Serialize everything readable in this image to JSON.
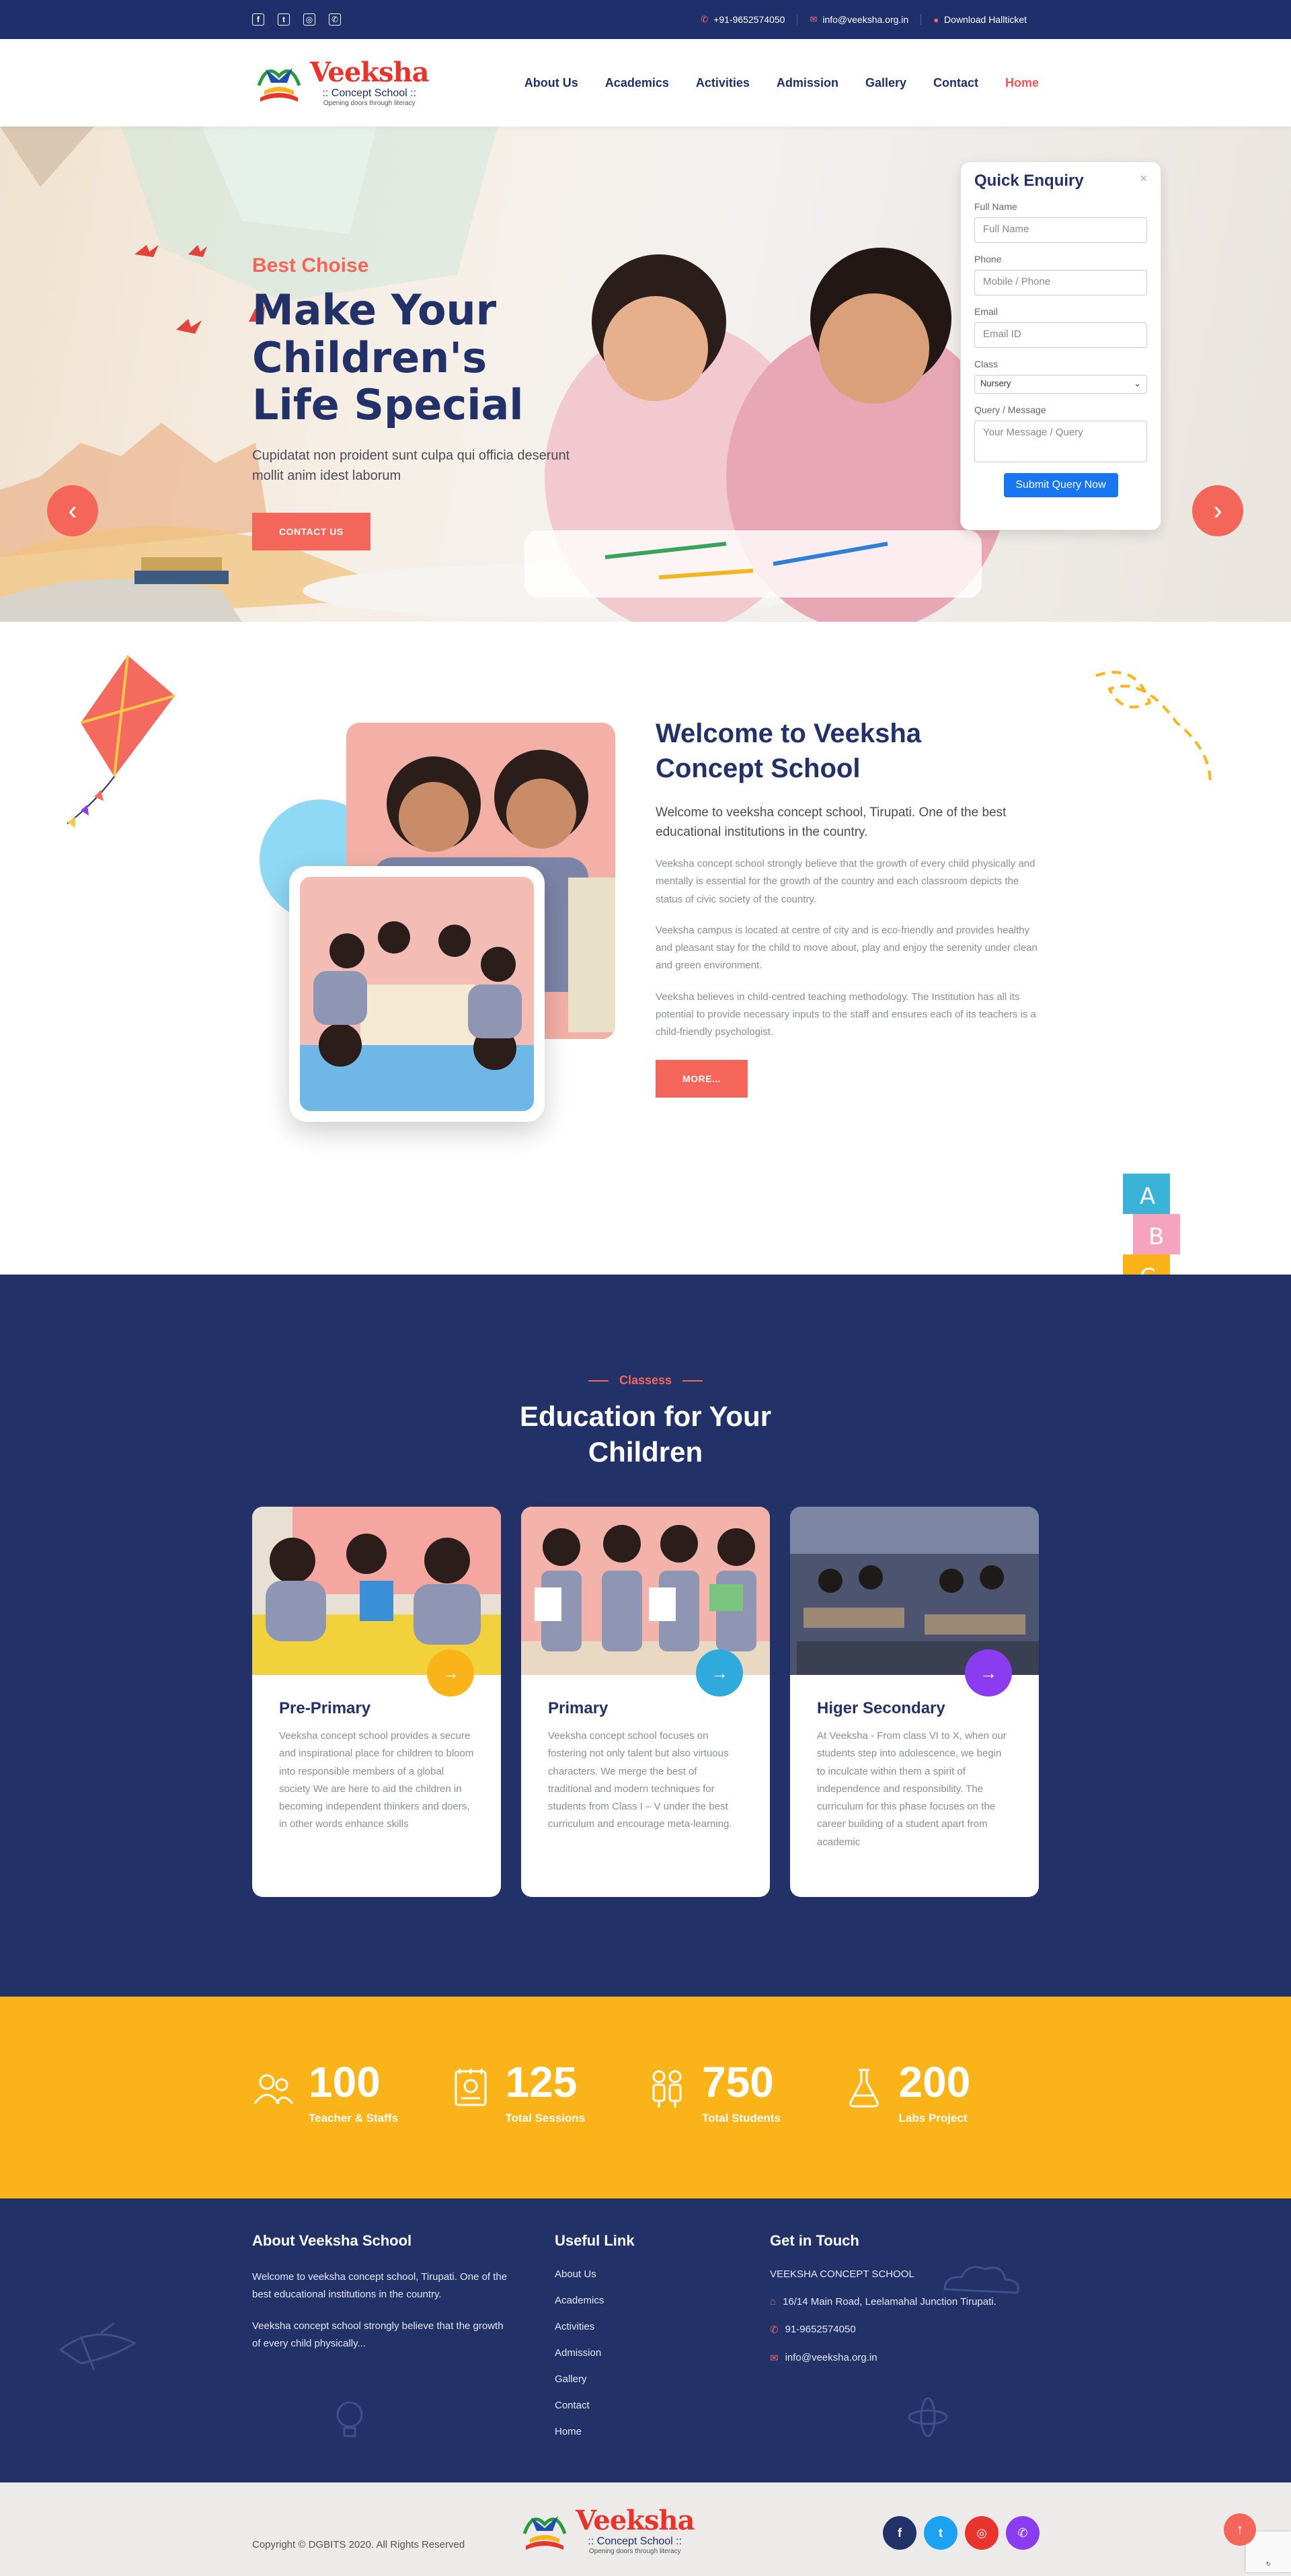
{
  "topbar": {
    "phone": "+91-9652574050",
    "email": "info@veeksha.org.in",
    "hallticket": "Download Hallticket"
  },
  "logo": {
    "name": "Veeksha",
    "sub": "Concept School",
    "tagline": "Opening doors through literacy"
  },
  "nav": [
    "About Us",
    "Academics",
    "Activities",
    "Admission",
    "Gallery",
    "Contact",
    "Home"
  ],
  "hero": {
    "kicker": "Best Choise",
    "title_line1": "Make Your Children's",
    "title_line2": "Life Special",
    "text": "Cupidatat non proident sunt culpa qui officia deserunt mollit anim idest laborum",
    "button": "CONTACT US"
  },
  "enquiry": {
    "title": "Quick Enquiry",
    "close": "×",
    "fields": [
      {
        "label": "Full Name",
        "placeholder": "Full Name"
      },
      {
        "label": "Phone",
        "placeholder": "Mobile / Phone"
      },
      {
        "label": "Email",
        "placeholder": "Email ID"
      }
    ],
    "class_label": "Class",
    "class_value": "Nursery",
    "message_label": "Query / Message",
    "message_placeholder": "Your Message / Query",
    "submit": "Submit Query Now"
  },
  "welcome": {
    "title_line1": "Welcome to Veeksha",
    "title_line2": "Concept School",
    "lead": "Welcome to veeksha concept school, Tirupati. One of the best educational institutions in the country.",
    "p1": "Veeksha concept school strongly believe that the growth of every child physically and mentally is essential for the growth of the country and each classroom depicts the status of civic society of the country.",
    "p2": "Veeksha campus is located at centre of city and is eco-friendly and provides healthy and pleasant stay for the child to move about, play and enjoy the serenity under clean and green environment.",
    "p3": "Veeksha believes in child-centred teaching methodology. The Institution has all its potential to provide necessary inputs to the staff and ensures each of its teachers is a child-friendly psychologist.",
    "button": "MORE..."
  },
  "classes": {
    "eyebrow": "Classess",
    "title_line1": "Education for Your",
    "title_line2": "Children",
    "cards": [
      {
        "title": "Pre-Primary",
        "color": "#fbb31a",
        "text": "Veeksha concept school provides a secure and inspirational place for children to bloom into responsible members of a global society We are here to aid the children in becoming independent thinkers and doers, in other words enhance skills"
      },
      {
        "title": "Primary",
        "color": "#2eaadc",
        "text": "Veeksha concept school focuses on fostering not only talent but also virtuous characters. We merge the best of traditional and modern techniques for students from Class I – V under the best curriculum and encourage meta-learning."
      },
      {
        "title": "Higer Secondary",
        "color": "#8b3cf0",
        "text": "At Veeksha - From class VI to X, when our students step into adolescence, we begin to inculcate within them a spirit of independence and responsibility. The curriculum for this phase focuses on the career building of a student apart from academic"
      }
    ]
  },
  "counters": [
    {
      "num": "100",
      "label": "Teacher & Staffs",
      "icon": "users-icon"
    },
    {
      "num": "125",
      "label": "Total Sessions",
      "icon": "notebook-icon"
    },
    {
      "num": "750",
      "label": "Total Students",
      "icon": "students-icon"
    },
    {
      "num": "200",
      "label": "Labs Project",
      "icon": "flask-icon"
    }
  ],
  "footer": {
    "about_title": "About Veeksha School",
    "about_p1": "Welcome to veeksha concept school, Tirupati. One of the best educational institutions in the country.",
    "about_p2": "Veeksha concept school strongly believe that the growth of every child physically...",
    "links_title": "Useful Link",
    "links": [
      "About Us",
      "Academics",
      "Activities",
      "Admission",
      "Gallery",
      "Contact",
      "Home"
    ],
    "contact_title": "Get in Touch",
    "school": "VEEKSHA CONCEPT SCHOOL",
    "address": "16/14 Main Road, Leelamahal Junction Tirupati.",
    "phone": "91-9652574050",
    "email": "info@veeksha.org.in"
  },
  "bottom": {
    "copyright": "Copyright © DGBITS 2020. All Rights Reserved",
    "socials": [
      {
        "name": "facebook",
        "glyph": "f",
        "color": "#223269"
      },
      {
        "name": "twitter",
        "glyph": "t",
        "color": "#1da1f2"
      },
      {
        "name": "instagram",
        "glyph": "◎",
        "color": "#e8342c"
      },
      {
        "name": "whatsapp",
        "glyph": "✆",
        "color": "#8b3cf0"
      }
    ]
  },
  "colors": {
    "navy": "#223269",
    "coral": "#f4665a",
    "yellow": "#fbb31a"
  }
}
